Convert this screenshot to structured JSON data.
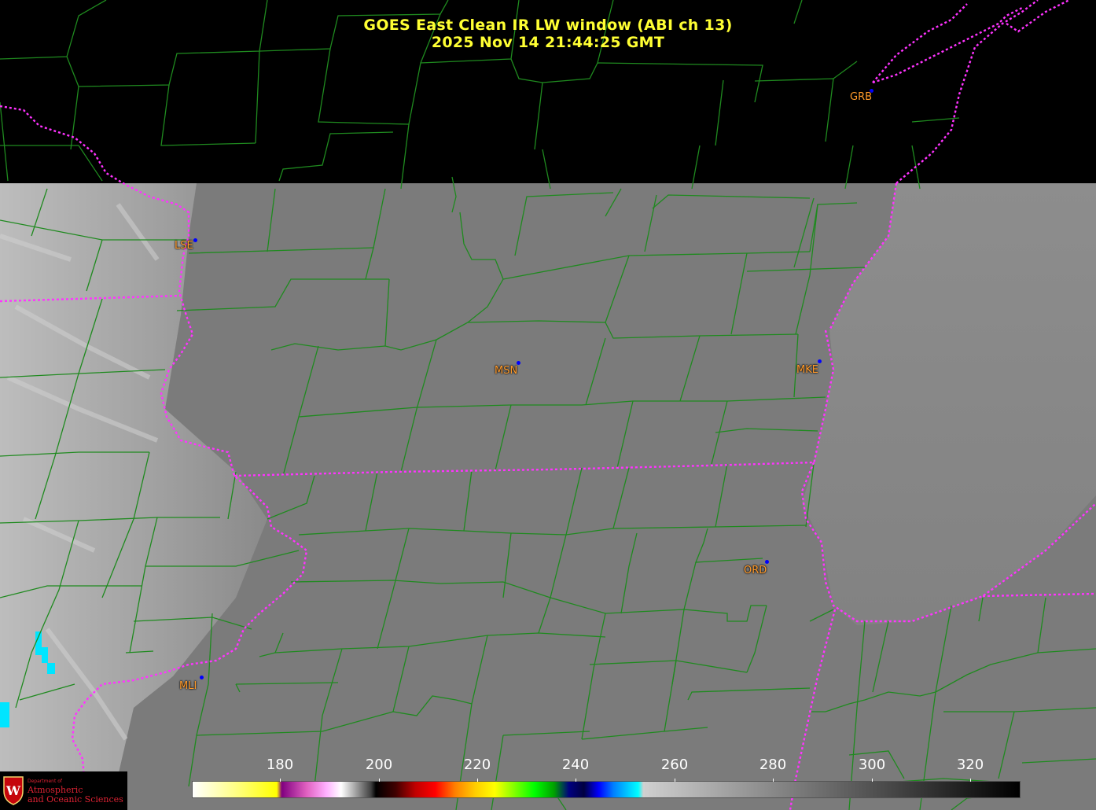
{
  "title": {
    "line1": "GOES East Clean IR LW window (ABI ch 13)",
    "line2": "2025 Nov 14  21:44:25 GMT"
  },
  "stations": [
    {
      "id": "GRB",
      "name": "GRB"
    },
    {
      "id": "LSE",
      "name": "LSE"
    },
    {
      "id": "MSN",
      "name": "MSN"
    },
    {
      "id": "MKE",
      "name": "MKE"
    },
    {
      "id": "ORD",
      "name": "ORD"
    },
    {
      "id": "MLI",
      "name": "MLI"
    }
  ],
  "colorbar": {
    "unit_min": 163,
    "unit_max": 330,
    "ticks": [
      "180",
      "200",
      "220",
      "240",
      "260",
      "280",
      "300",
      "320"
    ]
  },
  "logo": {
    "small": "Department of",
    "line1": "Atmospheric",
    "line2": "and Oceanic Sciences"
  },
  "colors": {
    "title": "#ffff33",
    "county_lines": "#1f8a1f",
    "state_lines": "#ff33ff",
    "station_label": "#ff9a2a",
    "station_dot": "#0000ff"
  }
}
